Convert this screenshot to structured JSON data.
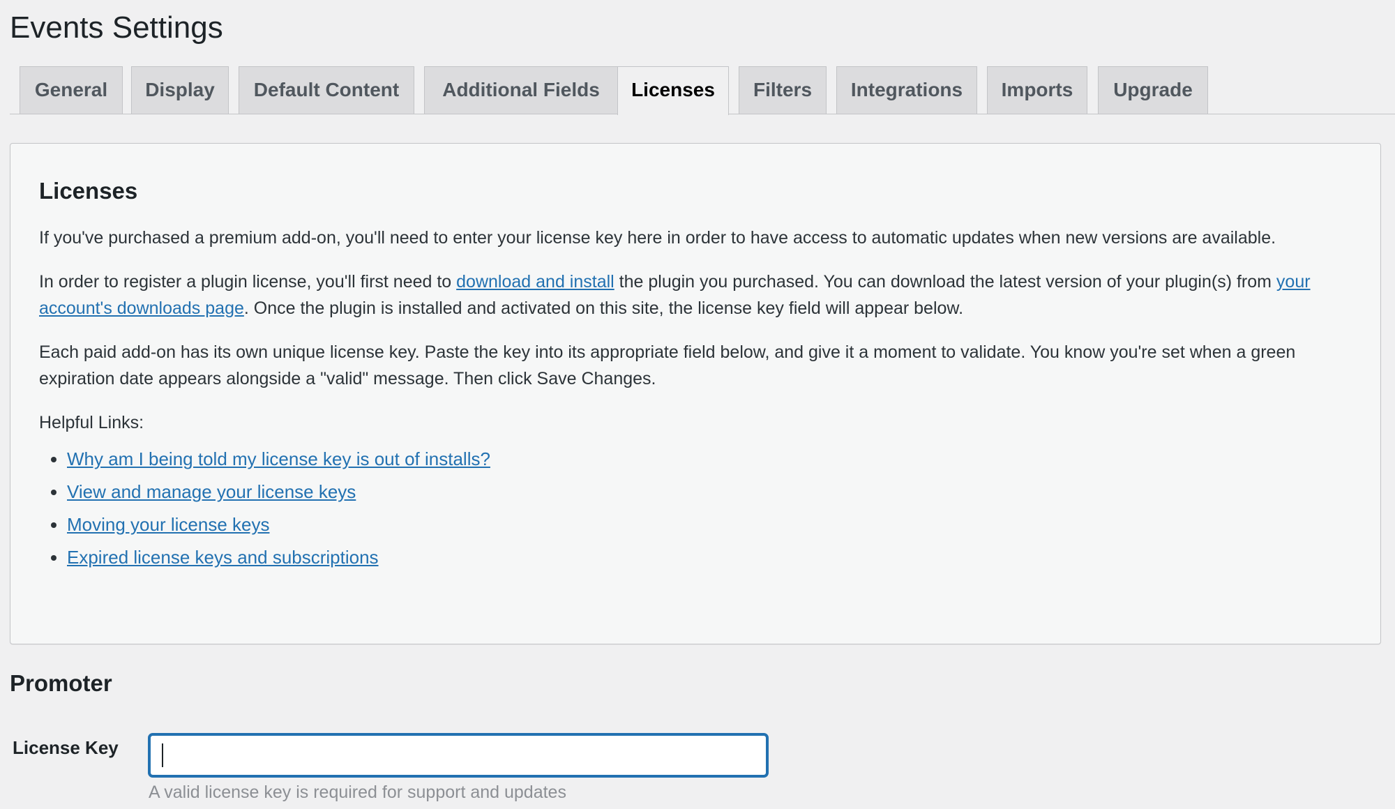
{
  "page_title": "Events Settings",
  "tabs": [
    {
      "label": "General",
      "active": false
    },
    {
      "label": "Display",
      "active": false
    },
    {
      "label": "Default Content",
      "active": false
    },
    {
      "label": "Additional Fields",
      "active": false
    },
    {
      "label": "Licenses",
      "active": true
    },
    {
      "label": "Filters",
      "active": false
    },
    {
      "label": "Integrations",
      "active": false
    },
    {
      "label": "Imports",
      "active": false
    },
    {
      "label": "Upgrade",
      "active": false
    }
  ],
  "licenses_box": {
    "heading": "Licenses",
    "para1": "If you've purchased a premium add-on, you'll need to enter your license key here in order to have access to automatic updates when new versions are available.",
    "para2": {
      "before_link1": "In order to register a plugin license, you'll first need to ",
      "link1": "download and install",
      "between_links": " the plugin you purchased. You can download the latest version of your plugin(s) from ",
      "link2": "your account's downloads page",
      "after_link2": ". Once the plugin is installed and activated on this site, the license key field will appear below."
    },
    "para3": "Each paid add-on has its own unique license key. Paste the key into its appropriate field below, and give it a moment to validate. You know you're set when a green expiration date appears alongside a \"valid\" message. Then click Save Changes.",
    "helpful_links_label": "Helpful Links:",
    "helpful_links": [
      "Why am I being told my license key is out of installs?",
      "View and manage your license keys",
      "Moving your license keys",
      "Expired license keys and subscriptions"
    ]
  },
  "promoter": {
    "section_title": "Promoter",
    "field_label": "License Key",
    "field_value": "",
    "help_text": "A valid license key is required for support and updates"
  },
  "colors": {
    "link": "#2271b1",
    "input_focus_border": "#2271b1",
    "background": "#f0f0f1",
    "tab_inactive": "#dcdcde"
  }
}
